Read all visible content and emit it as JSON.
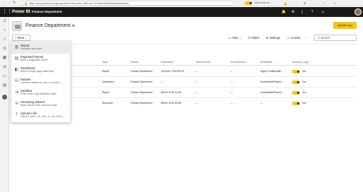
{
  "browser": {
    "url": "https://dxt.powerbi.com/groups/60e1b4ba-e06c-4f96-ac17-57fa0b0f5e3d/list/dashboards",
    "back_icon": "arrow-left-icon",
    "new_look_label": "New look on"
  },
  "topbar": {
    "brand": "Power BI",
    "workspace": "Finance Department",
    "colors": {
      "bar": "#1b1a19",
      "accent": "#f2c811"
    }
  },
  "header": {
    "title": "Finance Department",
    "update_app_label": "Update app"
  },
  "toolbar": {
    "new_label": "New",
    "view_label": "View",
    "filters_label": "Filters",
    "settings_label": "Settings",
    "access_label": "Access",
    "search_placeholder": "Search"
  },
  "new_menu": [
    {
      "title": "Report",
      "desc": "Visualize your data",
      "icon": "report-icon"
    },
    {
      "title": "Paginated Report",
      "desc": "Build a paginated report",
      "icon": "paginated-report-icon"
    },
    {
      "title": "Dashboard",
      "desc": "Build a single-page data story",
      "icon": "dashboard-icon"
    },
    {
      "title": "Dataset",
      "desc": "Create a dataset to use in a report",
      "icon": "dataset-icon"
    },
    {
      "title": "Dataflow",
      "desc": "Prep, clean, and transform data",
      "icon": "dataflow-icon"
    },
    {
      "title": "Streaming dataset",
      "desc": "Build visuals from real-time data",
      "icon": "streaming-icon"
    },
    {
      "title": "Upload a file",
      "desc": "Open a .pbix, .rdl, .xlsx, or .csv in Po...",
      "icon": "upload-icon"
    }
  ],
  "table": {
    "headers": {
      "type": "Type",
      "owner": "Owner",
      "refreshed": "Refreshed",
      "next_refresh": "Next refresh",
      "endorsement": "Endorsement",
      "sensitivity": "Sensitivity",
      "include": "Include in app"
    },
    "rows": [
      {
        "type": "Report",
        "owner": "Finance Department",
        "refreshed": "10/23/19, 3:09:09 PM",
        "next": "—",
        "endorse": "—",
        "sensitivity": "Highly Confidential\\...",
        "include": "Yes"
      },
      {
        "type": "Dashboard",
        "owner": "Finance Department",
        "refreshed": "—",
        "next": "—",
        "endorse": "—",
        "sensitivity": "Confidential\\Financi...",
        "include": "Yes"
      },
      {
        "type": "Report",
        "owner": "Finance Department",
        "refreshed": "8/5/19, 8:29:21 AM",
        "next": "—",
        "endorse": "—",
        "sensitivity": "Confidential\\Financi...",
        "include": "Yes"
      },
      {
        "type": "Workbook",
        "owner": "Finance Department",
        "refreshed": "8/5/19, 8:30:39 AM",
        "next": "—",
        "endorse": "—",
        "sensitivity": "—",
        "include": "Yes"
      }
    ]
  }
}
